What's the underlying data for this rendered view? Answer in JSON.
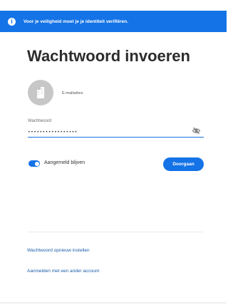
{
  "banner": {
    "info_icon": "info-icon",
    "message": "Voor je veiligheid moet je je identiteit verifiëren."
  },
  "page": {
    "title": "Wachtwoord invoeren"
  },
  "account": {
    "avatar_icon": "building-icon",
    "email_label": "E-mailadres"
  },
  "password": {
    "label": "Wachtwoord",
    "value": "•••••••••••••••••",
    "visibility_icon": "eye-slash-icon"
  },
  "remember": {
    "label": "Aangemeld blijven",
    "checked": true
  },
  "actions": {
    "continue_label": "Doorgaan"
  },
  "links": {
    "reset_password": "Wachtwoord opnieuw instellen",
    "other_account": "Aanmelden met een ander account"
  },
  "colors": {
    "accent": "#1473e6",
    "link": "#1a5ea8"
  }
}
